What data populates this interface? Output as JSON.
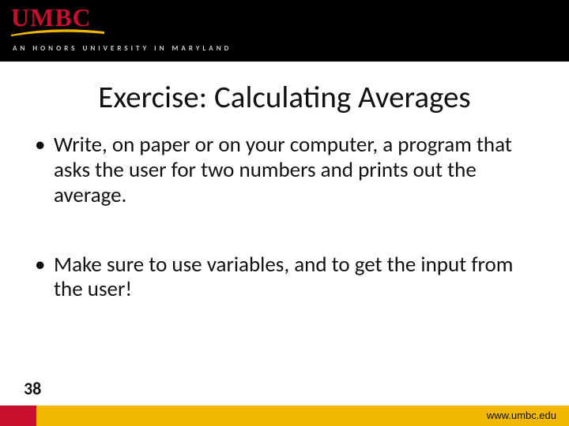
{
  "header": {
    "logo_text": "UMBC",
    "tagline": "AN HONORS UNIVERSITY IN MARYLAND"
  },
  "title": "Exercise: Calculating Averages",
  "bullets": [
    "Write, on paper or on your computer, a program that asks the user for two numbers and prints out the average.",
    "Make sure to use variables, and to get the input from the user!"
  ],
  "footer": {
    "page_number": "38",
    "url": "www.umbc.edu"
  }
}
